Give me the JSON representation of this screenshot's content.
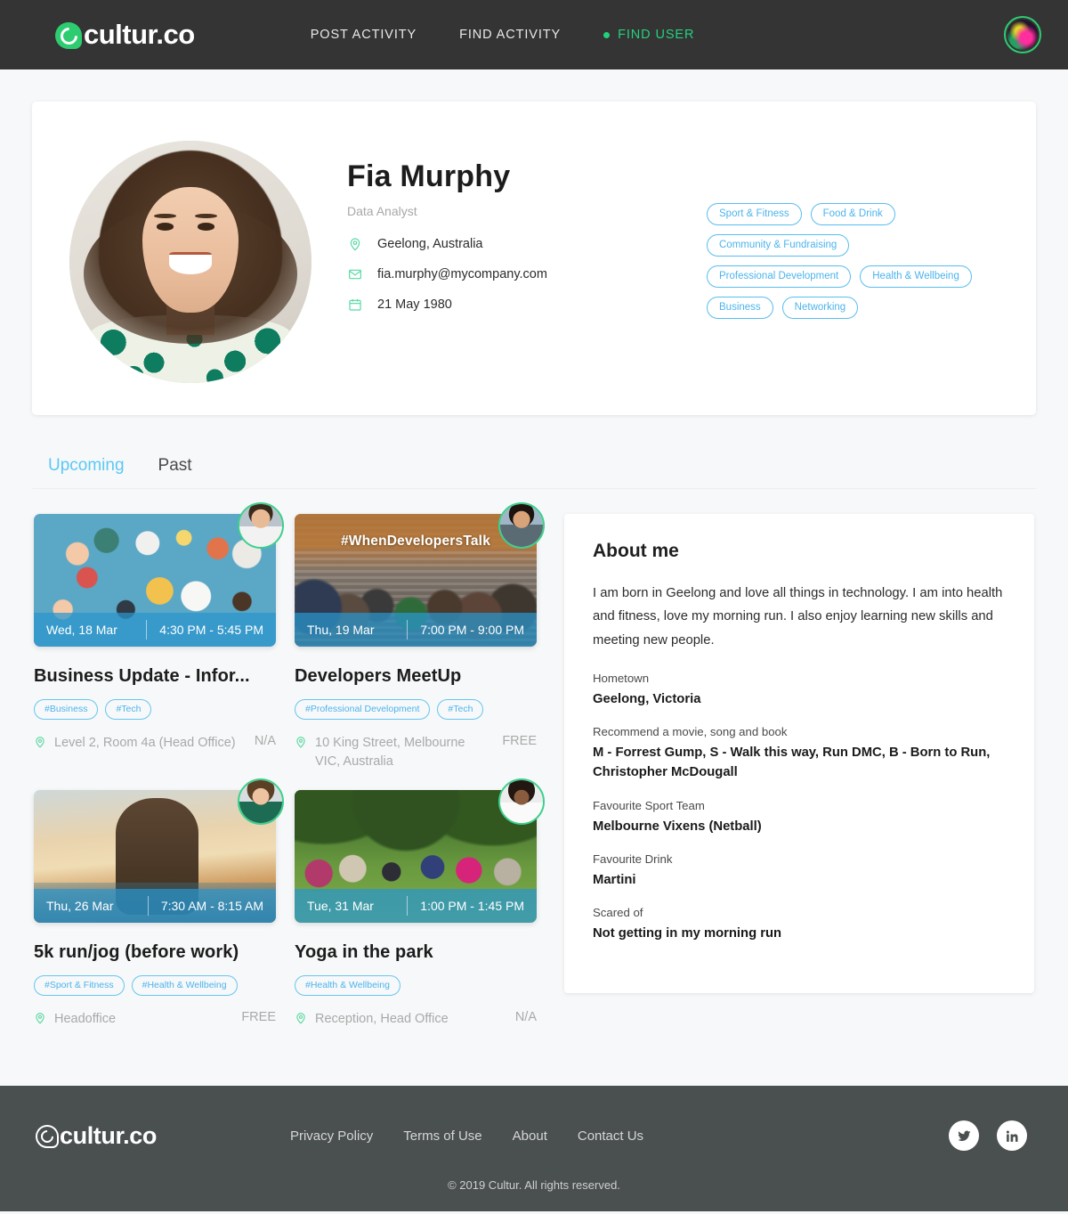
{
  "header": {
    "logo_text": "cultur.co",
    "nav": [
      {
        "label": "POST ACTIVITY",
        "active": false
      },
      {
        "label": "FIND ACTIVITY",
        "active": false
      },
      {
        "label": "FIND USER",
        "active": true
      }
    ],
    "avatar_alt": "user-avatar"
  },
  "profile": {
    "name": "Fia Murphy",
    "role": "Data Analyst",
    "location": "Geelong, Australia",
    "email": "fia.murphy@mycompany.com",
    "birthday": "21 May 1980",
    "interests": [
      "Sport & Fitness",
      "Food & Drink",
      "Community & Fundraising",
      "Professional Development",
      "Health & Wellbeing",
      "Business",
      "Networking"
    ]
  },
  "tabs": [
    {
      "label": "Upcoming",
      "active": true
    },
    {
      "label": "Past",
      "active": false
    }
  ],
  "events": [
    {
      "date": "Wed, 18 Mar",
      "time": "4:30 PM - 5:45 PM",
      "title": "Business Update - Infor...",
      "tags": [
        "#Business",
        "#Tech"
      ],
      "location": "Level 2, Room 4a (Head Office)",
      "price": "N/A",
      "overlay_text": ""
    },
    {
      "date": "Thu, 19 Mar",
      "time": "7:00 PM - 9:00 PM",
      "title": "Developers MeetUp",
      "tags": [
        "#Professional Development",
        "#Tech"
      ],
      "location": "10 King Street, Melbourne VIC, Australia",
      "price": "FREE",
      "overlay_text": "#WhenDevelopersTalk"
    },
    {
      "date": "Thu, 26 Mar",
      "time": "7:30 AM - 8:15 AM",
      "title": "5k run/jog (before work)",
      "tags": [
        "#Sport & Fitness",
        "#Health & Wellbeing"
      ],
      "location": "Headoffice",
      "price": "FREE",
      "overlay_text": ""
    },
    {
      "date": "Tue, 31 Mar",
      "time": "1:00 PM - 1:45 PM",
      "title": "Yoga in the park",
      "tags": [
        "#Health & Wellbeing"
      ],
      "location": "Reception, Head Office",
      "price": "N/A",
      "overlay_text": ""
    }
  ],
  "about": {
    "title": "About me",
    "bio": "I am born in Geelong and love all things in technology. I am into health and fitness, love my morning run. I also enjoy learning new skills and meeting new people.",
    "fields": [
      {
        "label": "Hometown",
        "value": "Geelong, Victoria"
      },
      {
        "label": "Recommend a movie, song and book",
        "value": "M - Forrest Gump, S - Walk this way, Run DMC, B - Born to Run, Christopher McDougall"
      },
      {
        "label": "Favourite Sport Team",
        "value": "Melbourne Vixens (Netball)"
      },
      {
        "label": "Favourite Drink",
        "value": "Martini"
      },
      {
        "label": "Scared of",
        "value": "Not getting in my morning run"
      }
    ]
  },
  "footer": {
    "logo_text": "cultur.co",
    "links": [
      "Privacy Policy",
      "Terms of Use",
      "About",
      "Contact Us"
    ],
    "social": [
      "twitter-icon",
      "linkedin-icon"
    ],
    "copyright": "© 2019 Cultur. All rights reserved."
  },
  "colors": {
    "header_bg": "#343434",
    "footer_bg": "#4a4f4f",
    "accent_green": "#25d07d",
    "accent_blue": "#4cb4ec",
    "tab_active": "#5cc8f5",
    "page_bg": "#f7f8f9"
  }
}
